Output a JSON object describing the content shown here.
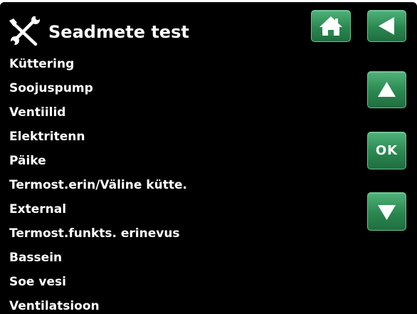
{
  "header": {
    "title": "Seadmete test",
    "title_icon": "tools-icon"
  },
  "nav": {
    "home_icon": "home-icon",
    "back_icon": "back-arrow-icon",
    "up_icon": "arrow-up-icon",
    "ok_label": "OK",
    "down_icon": "arrow-down-icon"
  },
  "menu": {
    "items": [
      {
        "label": "Küttering"
      },
      {
        "label": "Soojuspump"
      },
      {
        "label": "Ventiilid"
      },
      {
        "label": "Elektritenn"
      },
      {
        "label": "Päike"
      },
      {
        "label": "Termost.erin/Väline kütte."
      },
      {
        "label": "External"
      },
      {
        "label": "Termost.funkts. erinevus"
      },
      {
        "label": "Bassein"
      },
      {
        "label": "Soe vesi"
      },
      {
        "label": "Ventilatsioon"
      }
    ]
  },
  "colors": {
    "background": "#000000",
    "text": "#ffffff",
    "button": "#2a8750",
    "button_border": "#67c48f"
  }
}
